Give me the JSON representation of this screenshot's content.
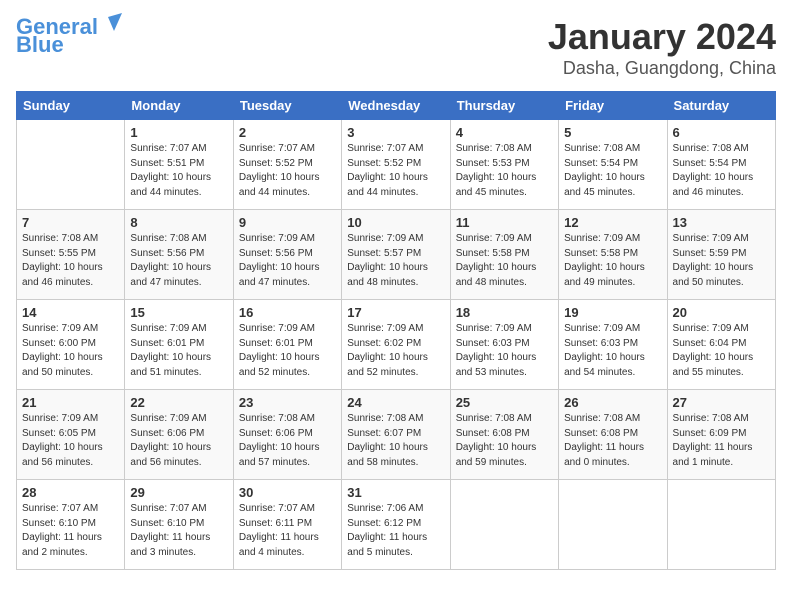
{
  "header": {
    "logo_line1": "General",
    "logo_line2": "Blue",
    "month_title": "January 2024",
    "location": "Dasha, Guangdong, China"
  },
  "weekdays": [
    "Sunday",
    "Monday",
    "Tuesday",
    "Wednesday",
    "Thursday",
    "Friday",
    "Saturday"
  ],
  "weeks": [
    [
      {
        "day": "",
        "info": ""
      },
      {
        "day": "1",
        "info": "Sunrise: 7:07 AM\nSunset: 5:51 PM\nDaylight: 10 hours and 44 minutes."
      },
      {
        "day": "2",
        "info": "Sunrise: 7:07 AM\nSunset: 5:52 PM\nDaylight: 10 hours and 44 minutes."
      },
      {
        "day": "3",
        "info": "Sunrise: 7:07 AM\nSunset: 5:52 PM\nDaylight: 10 hours and 44 minutes."
      },
      {
        "day": "4",
        "info": "Sunrise: 7:08 AM\nSunset: 5:53 PM\nDaylight: 10 hours and 45 minutes."
      },
      {
        "day": "5",
        "info": "Sunrise: 7:08 AM\nSunset: 5:54 PM\nDaylight: 10 hours and 45 minutes."
      },
      {
        "day": "6",
        "info": "Sunrise: 7:08 AM\nSunset: 5:54 PM\nDaylight: 10 hours and 46 minutes."
      }
    ],
    [
      {
        "day": "7",
        "info": "Sunrise: 7:08 AM\nSunset: 5:55 PM\nDaylight: 10 hours and 46 minutes."
      },
      {
        "day": "8",
        "info": "Sunrise: 7:08 AM\nSunset: 5:56 PM\nDaylight: 10 hours and 47 minutes."
      },
      {
        "day": "9",
        "info": "Sunrise: 7:09 AM\nSunset: 5:56 PM\nDaylight: 10 hours and 47 minutes."
      },
      {
        "day": "10",
        "info": "Sunrise: 7:09 AM\nSunset: 5:57 PM\nDaylight: 10 hours and 48 minutes."
      },
      {
        "day": "11",
        "info": "Sunrise: 7:09 AM\nSunset: 5:58 PM\nDaylight: 10 hours and 48 minutes."
      },
      {
        "day": "12",
        "info": "Sunrise: 7:09 AM\nSunset: 5:58 PM\nDaylight: 10 hours and 49 minutes."
      },
      {
        "day": "13",
        "info": "Sunrise: 7:09 AM\nSunset: 5:59 PM\nDaylight: 10 hours and 50 minutes."
      }
    ],
    [
      {
        "day": "14",
        "info": "Sunrise: 7:09 AM\nSunset: 6:00 PM\nDaylight: 10 hours and 50 minutes."
      },
      {
        "day": "15",
        "info": "Sunrise: 7:09 AM\nSunset: 6:01 PM\nDaylight: 10 hours and 51 minutes."
      },
      {
        "day": "16",
        "info": "Sunrise: 7:09 AM\nSunset: 6:01 PM\nDaylight: 10 hours and 52 minutes."
      },
      {
        "day": "17",
        "info": "Sunrise: 7:09 AM\nSunset: 6:02 PM\nDaylight: 10 hours and 52 minutes."
      },
      {
        "day": "18",
        "info": "Sunrise: 7:09 AM\nSunset: 6:03 PM\nDaylight: 10 hours and 53 minutes."
      },
      {
        "day": "19",
        "info": "Sunrise: 7:09 AM\nSunset: 6:03 PM\nDaylight: 10 hours and 54 minutes."
      },
      {
        "day": "20",
        "info": "Sunrise: 7:09 AM\nSunset: 6:04 PM\nDaylight: 10 hours and 55 minutes."
      }
    ],
    [
      {
        "day": "21",
        "info": "Sunrise: 7:09 AM\nSunset: 6:05 PM\nDaylight: 10 hours and 56 minutes."
      },
      {
        "day": "22",
        "info": "Sunrise: 7:09 AM\nSunset: 6:06 PM\nDaylight: 10 hours and 56 minutes."
      },
      {
        "day": "23",
        "info": "Sunrise: 7:08 AM\nSunset: 6:06 PM\nDaylight: 10 hours and 57 minutes."
      },
      {
        "day": "24",
        "info": "Sunrise: 7:08 AM\nSunset: 6:07 PM\nDaylight: 10 hours and 58 minutes."
      },
      {
        "day": "25",
        "info": "Sunrise: 7:08 AM\nSunset: 6:08 PM\nDaylight: 10 hours and 59 minutes."
      },
      {
        "day": "26",
        "info": "Sunrise: 7:08 AM\nSunset: 6:08 PM\nDaylight: 11 hours and 0 minutes."
      },
      {
        "day": "27",
        "info": "Sunrise: 7:08 AM\nSunset: 6:09 PM\nDaylight: 11 hours and 1 minute."
      }
    ],
    [
      {
        "day": "28",
        "info": "Sunrise: 7:07 AM\nSunset: 6:10 PM\nDaylight: 11 hours and 2 minutes."
      },
      {
        "day": "29",
        "info": "Sunrise: 7:07 AM\nSunset: 6:10 PM\nDaylight: 11 hours and 3 minutes."
      },
      {
        "day": "30",
        "info": "Sunrise: 7:07 AM\nSunset: 6:11 PM\nDaylight: 11 hours and 4 minutes."
      },
      {
        "day": "31",
        "info": "Sunrise: 7:06 AM\nSunset: 6:12 PM\nDaylight: 11 hours and 5 minutes."
      },
      {
        "day": "",
        "info": ""
      },
      {
        "day": "",
        "info": ""
      },
      {
        "day": "",
        "info": ""
      }
    ]
  ]
}
